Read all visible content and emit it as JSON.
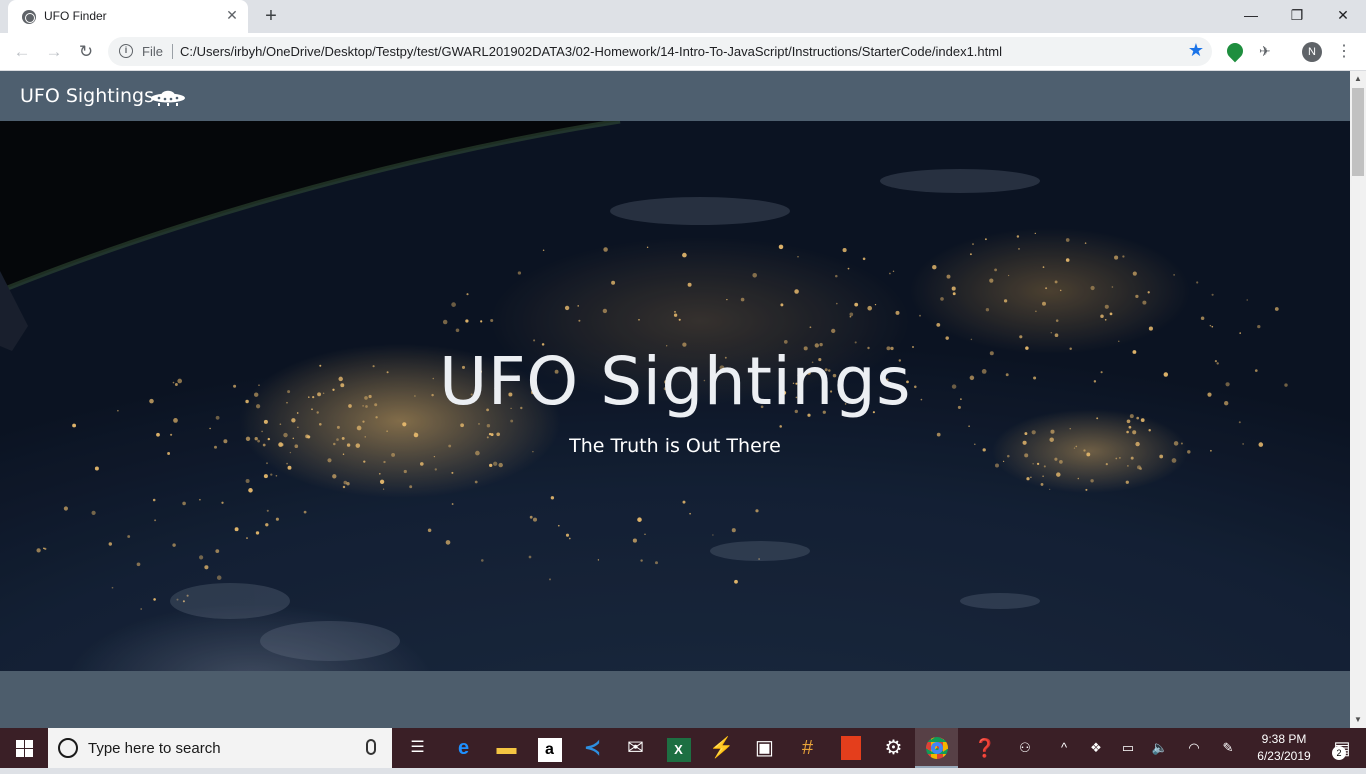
{
  "browser": {
    "tab_title": "UFO Finder",
    "tab_close": "✕",
    "new_tab": "+",
    "window_controls": {
      "minimize": "—",
      "restore": "❐",
      "close": "✕"
    },
    "nav": {
      "back": "←",
      "forward": "→",
      "reload": "↻"
    },
    "omnibox": {
      "file_label": "File",
      "url": "C:/Users/irbyh/OneDrive/Desktop/Testpy/test/GWARL201902DATA3/02-Homework/14-Intro-To-JavaScript/Instructions/StarterCode/index1.html",
      "bookmarked": true
    },
    "profile_initial": "N",
    "menu": "⋮",
    "accent_color": "#1a73e8"
  },
  "page": {
    "navbar": {
      "brand": "UFO Sightings",
      "background": "#4e5f6f"
    },
    "hero": {
      "title": "UFO Sightings",
      "subtitle": "The Truth is Out There"
    },
    "body_background": "#4d5d6c"
  },
  "taskbar": {
    "search_placeholder": "Type here to search",
    "apps": [
      "task-view-icon",
      "edge-icon",
      "file-explorer-icon",
      "amazon-icon",
      "vscode-icon",
      "mail-icon",
      "excel-icon",
      "azure-icon",
      "store-icon",
      "slack-icon",
      "office-icon",
      "settings-icon",
      "chrome-icon"
    ],
    "clock_time": "9:38 PM",
    "clock_date": "6/23/2019",
    "notification_count": "2",
    "background": "#3a1f26"
  }
}
